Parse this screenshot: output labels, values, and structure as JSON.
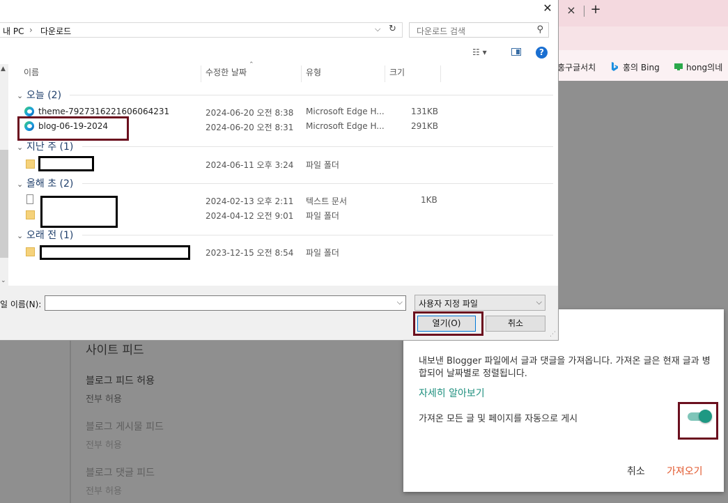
{
  "browser": {
    "tab_close": "×",
    "new_tab": "+",
    "bookmarks": [
      {
        "label": "홍구글서치",
        "icon": "none"
      },
      {
        "label": "홍의 Bing",
        "icon": "bing-icon"
      },
      {
        "label": "hong의네",
        "icon": "monitor-icon"
      }
    ]
  },
  "page": {
    "site_feed_title": "사이트 피드",
    "blog_feed_label": "블로그 피드 허용",
    "blog_feed_value": "전부 허용",
    "post_feed_label": "블로그 게시물 피드",
    "post_feed_value": "전부 허용",
    "comment_feed_label": "블로그 댓글 피드",
    "comment_feed_value": "전부 허용"
  },
  "import_dialog": {
    "description": "내보낸 Blogger 파일에서 글과 댓글을 가져옵니다. 가져온 글은 현재 글과 병합되어 날짜별로 정렬됩니다.",
    "learn_more": "자세히 알아보기",
    "auto_publish_label": "가져온 모든 글 및 페이지를 자동으로 게시",
    "auto_publish_on": true,
    "cancel": "취소",
    "import": "가져오기",
    "accent_color": "#1e9883",
    "import_color": "#e2572c"
  },
  "file_dialog": {
    "close": "✕",
    "path": [
      "내 PC",
      "다운로드"
    ],
    "path_sep": "›",
    "search_placeholder": "다운로드 검색",
    "columns": {
      "name": "이름",
      "modified": "수정한 날짜",
      "type": "유형",
      "size": "크기"
    },
    "groups": [
      {
        "label": "오늘 (2)",
        "files": [
          {
            "name": "theme-7927316221606064231",
            "date": "2024-06-20 오전 8:38",
            "type": "Microsoft Edge H...",
            "size": "131KB",
            "icon": "edge-icon"
          },
          {
            "name": "blog-06-19-2024",
            "date": "2024-06-20 오전 8:31",
            "type": "Microsoft Edge H...",
            "size": "291KB",
            "icon": "edge-icon"
          }
        ]
      },
      {
        "label": "지난 주 (1)",
        "files": [
          {
            "name": "",
            "date": "2024-06-11 오후 3:24",
            "type": "파일 폴더",
            "size": "",
            "icon": "folder-icon"
          }
        ]
      },
      {
        "label": "올해 초 (2)",
        "files": [
          {
            "name": "",
            "date": "2024-02-13 오후 2:11",
            "type": "텍스트 문서",
            "size": "1KB",
            "icon": "document-icon"
          },
          {
            "name": "",
            "date": "2024-04-12 오전 9:01",
            "type": "파일 폴더",
            "size": "",
            "icon": "folder-icon"
          }
        ]
      },
      {
        "label": "오래 전 (1)",
        "files": [
          {
            "name": "",
            "date": "2023-12-15 오전 8:54",
            "type": "파일 폴더",
            "size": "",
            "icon": "folder-icon"
          }
        ]
      }
    ],
    "filename_label": "일 이름(N):",
    "filename_value": "",
    "filetype": "사용자 지정 파일",
    "open_button": "열기(O)",
    "cancel_button": "취소"
  },
  "annotation_color": "#6b0f1e"
}
